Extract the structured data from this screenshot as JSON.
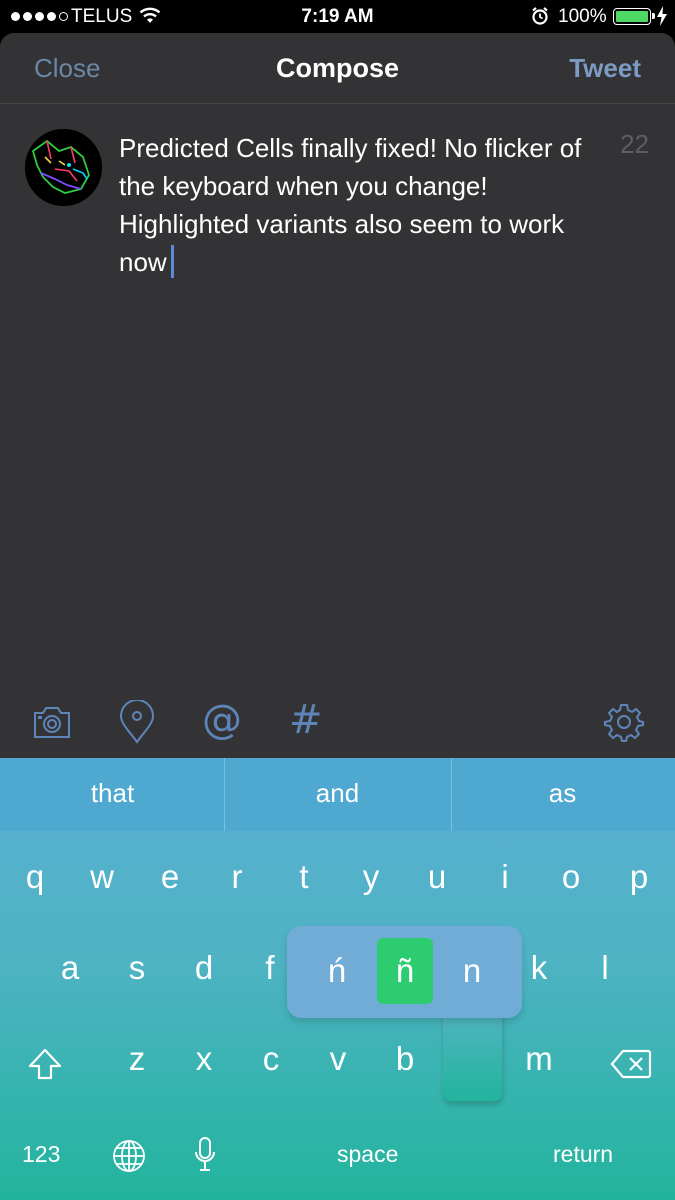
{
  "status_bar": {
    "carrier": "TELUS",
    "time": "7:19 AM",
    "battery": "100%",
    "battery_color": "#4cd964"
  },
  "nav": {
    "close_label": "Close",
    "title": "Compose",
    "tweet_label": "Tweet"
  },
  "compose": {
    "text": "Predicted Cells finally fixed! No flicker of the keyboard when you change! Highlighted variants also seem to work now",
    "char_count": "22"
  },
  "toolbar": {
    "icons": [
      "camera-icon",
      "location-pin-icon",
      "mention-icon",
      "hashtag-icon",
      "gear-icon"
    ],
    "mention_glyph": "@",
    "hashtag_glyph": "#",
    "icon_color": "#5e85ba"
  },
  "keyboard": {
    "suggestions": [
      "that",
      "and",
      "as"
    ],
    "row1": [
      "q",
      "w",
      "e",
      "r",
      "t",
      "y",
      "u",
      "i",
      "o",
      "p"
    ],
    "row2": [
      "a",
      "s",
      "d",
      "f",
      "k",
      "l"
    ],
    "row3": [
      "z",
      "x",
      "c",
      "v",
      "b",
      "m"
    ],
    "variants": [
      "ń",
      "ñ",
      "n"
    ],
    "selected_variant": "ñ",
    "selected_color": "#2ecc71",
    "numbers_label": "123",
    "space_label": "space",
    "return_label": "return"
  }
}
